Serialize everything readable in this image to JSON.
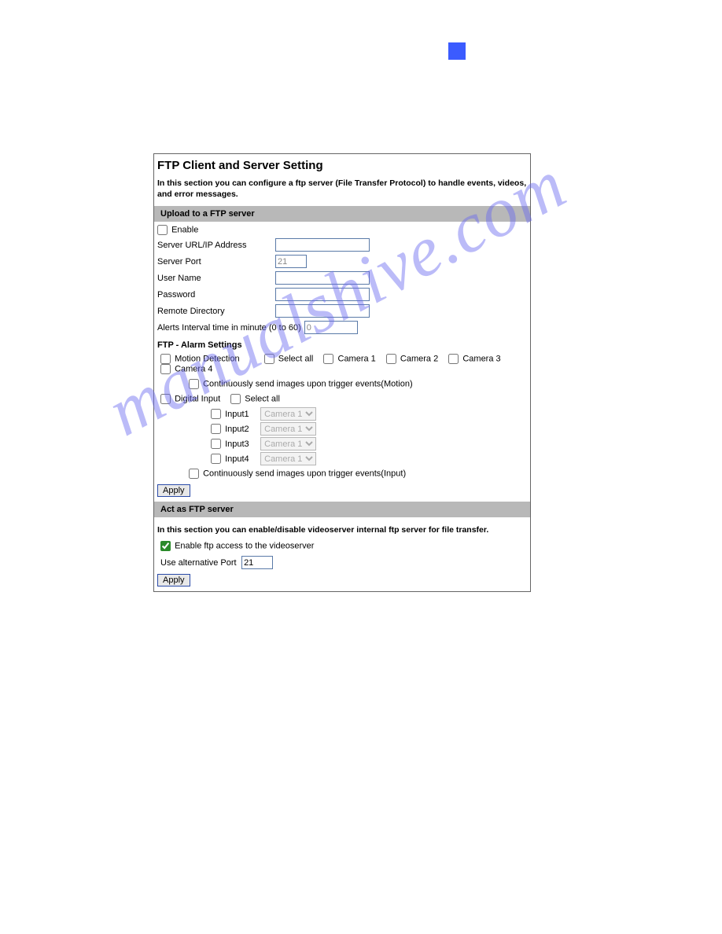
{
  "watermark": "manualshive.com",
  "panel": {
    "title": "FTP Client and Server Setting",
    "intro": "In this section you can configure a ftp server (File Transfer Protocol) to handle events, videos, and error messages."
  },
  "upload": {
    "header": "Upload to a FTP server",
    "enable_label": "Enable",
    "server_url_label": "Server URL/IP Address",
    "server_url_value": "",
    "server_port_label": "Server Port",
    "server_port_value": "21",
    "user_name_label": "User Name",
    "user_name_value": "",
    "password_label": "Password",
    "password_value": "",
    "remote_dir_label": "Remote Directory",
    "remote_dir_value": "",
    "alerts_interval_label": "Alerts Interval time in minute (0 to 60)",
    "alerts_interval_value": "0"
  },
  "alarm": {
    "header": "FTP - Alarm Settings",
    "motion_label": "Motion Detection",
    "select_all_label": "Select all",
    "camera1": "Camera 1",
    "camera2": "Camera 2",
    "camera3": "Camera 3",
    "camera4": "Camera 4",
    "cont_motion": "Continuously send images upon trigger events(Motion)",
    "digital_input_label": "Digital Input",
    "inputs": [
      {
        "label": "Input1",
        "camera": "Camera 1"
      },
      {
        "label": "Input2",
        "camera": "Camera 1"
      },
      {
        "label": "Input3",
        "camera": "Camera 1"
      },
      {
        "label": "Input4",
        "camera": "Camera 1"
      }
    ],
    "cont_input": "Continuously send images upon trigger events(Input)",
    "apply_label": "Apply"
  },
  "server": {
    "header": "Act as FTP server",
    "intro": "In this section you can enable/disable videoserver internal ftp server for file transfer.",
    "enable_ftp_label": "Enable ftp access to the videoserver",
    "alt_port_label": "Use alternative Port",
    "alt_port_value": "21",
    "apply_label": "Apply"
  }
}
